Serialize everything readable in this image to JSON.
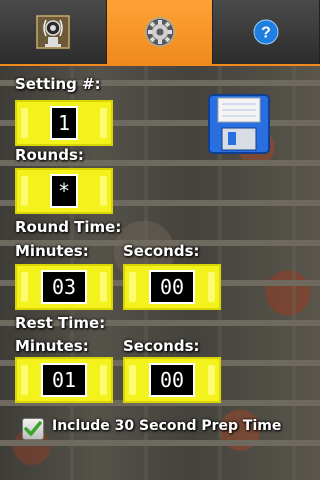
{
  "tabs": [
    {
      "name": "metronome-speaker-icon",
      "active": false
    },
    {
      "name": "settings-gear-icon",
      "active": true
    },
    {
      "name": "help-icon",
      "active": false,
      "glyph": "?"
    }
  ],
  "setting": {
    "label": "Setting #:",
    "value": "1"
  },
  "rounds": {
    "label": "Rounds:",
    "value": "*"
  },
  "round_time": {
    "label": "Round Time:",
    "minutes_label": "Minutes:",
    "minutes": "03",
    "seconds_label": "Seconds:",
    "seconds": "00"
  },
  "rest_time": {
    "label": "Rest Time:",
    "minutes_label": "Minutes:",
    "minutes": "01",
    "seconds_label": "Seconds:",
    "seconds": "00"
  },
  "prep": {
    "label": "Include 30 Second Prep Time",
    "checked": true
  },
  "colors": {
    "accent": "#f08a1c",
    "field": "#f4f21c",
    "check": "#3aa52a",
    "save": "#2a6fe0"
  }
}
